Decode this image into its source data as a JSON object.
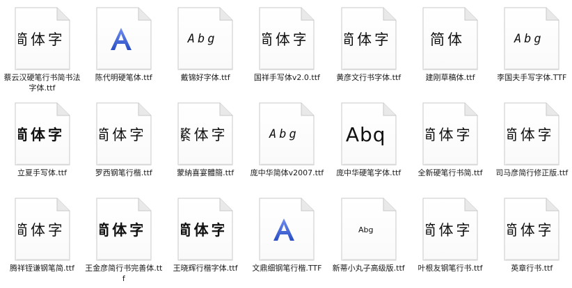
{
  "files": [
    {
      "label": "蔡云汉硬笔行书简书法字体.ttf",
      "preview": "简体字",
      "style": "hanzi"
    },
    {
      "label": "陈代明硬笔体.ttf",
      "preview": "A",
      "style": "logo"
    },
    {
      "label": "戴锦好字体.ttf",
      "preview": "Abg",
      "style": "abg"
    },
    {
      "label": "国祥手写体v2.0.ttf",
      "preview": "简体字",
      "style": "hanzi"
    },
    {
      "label": "黄彦文行书字体.ttf",
      "preview": "简体字",
      "style": "hanzi"
    },
    {
      "label": "建刚草稿体.ttf",
      "preview": "简体",
      "style": "hanzi"
    },
    {
      "label": "李国夫手写字体.TTF",
      "preview": "Abg",
      "style": "abg"
    },
    {
      "label": "立夏手写体.ttf",
      "preview": "简体字",
      "style": "hanzi-bold"
    },
    {
      "label": "罗西钢笔行楷.ttf",
      "preview": "简体字",
      "style": "hanzi"
    },
    {
      "label": "蒙納喜宴體簡.ttf",
      "preview": "繁体字",
      "style": "hanzi"
    },
    {
      "label": "庞中华简体v2007.ttf",
      "preview": "Abg",
      "style": "abg"
    },
    {
      "label": "庞中华硬笔字体.ttf",
      "preview": "Abq",
      "style": "abg-big"
    },
    {
      "label": "全新硬笔行书简.ttf",
      "preview": "简体字",
      "style": "hanzi"
    },
    {
      "label": "司马彦简行修正版.ttf",
      "preview": "简体字",
      "style": "hanzi"
    },
    {
      "label": "腾祥铚谦钢笔简.ttf",
      "preview": "简体字",
      "style": "hanzi"
    },
    {
      "label": "王金彦简行书完善体.ttf",
      "preview": "简体字",
      "style": "hanzi-bold"
    },
    {
      "label": "王晓辉行楷字体.ttf",
      "preview": "简体字",
      "style": "hanzi-bold"
    },
    {
      "label": "文鼎细钢笔行楷.TTF",
      "preview": "A",
      "style": "logo"
    },
    {
      "label": "新蒂小丸子高级版.ttf",
      "preview": "Abg",
      "style": "abg-small"
    },
    {
      "label": "叶根友钢笔行书.ttf",
      "preview": "简体字",
      "style": "hanzi"
    },
    {
      "label": "英章行书.ttf",
      "preview": "简体字",
      "style": "hanzi"
    }
  ],
  "colors": {
    "page_fill": "#fafafa",
    "page_border": "#c9c9c9",
    "fold_fill": "#e9e9e9",
    "logo_blue": "#2a4fc4"
  },
  "icons": {
    "file": "font-file-icon",
    "logo": "font-logo-icon"
  }
}
